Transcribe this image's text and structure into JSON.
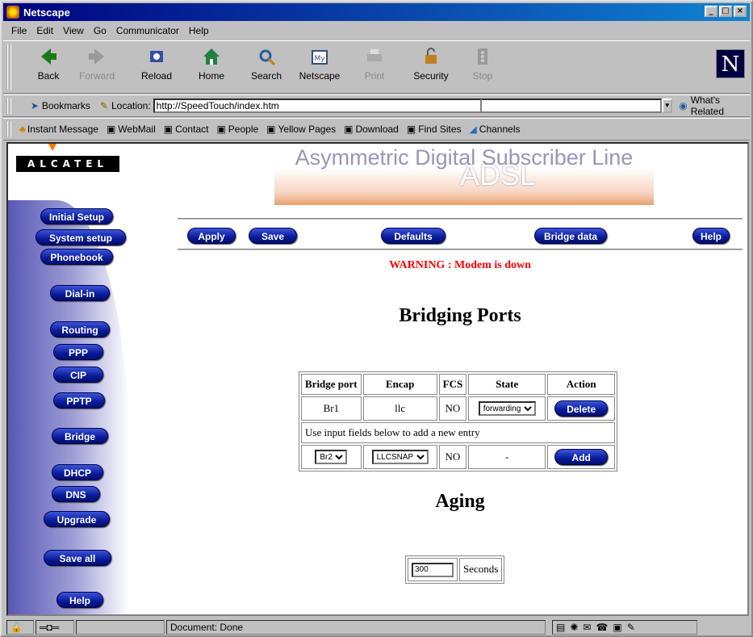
{
  "window": {
    "title": "Netscape"
  },
  "menu": [
    "File",
    "Edit",
    "View",
    "Go",
    "Communicator",
    "Help"
  ],
  "toolbar": {
    "buttons": [
      {
        "label": "Back",
        "icon": "back-arrow-icon",
        "enabled": true
      },
      {
        "label": "Forward",
        "icon": "forward-arrow-icon",
        "enabled": false
      },
      {
        "label": "Reload",
        "icon": "reload-icon",
        "enabled": true
      },
      {
        "label": "Home",
        "icon": "home-icon",
        "enabled": true
      },
      {
        "label": "Search",
        "icon": "search-icon",
        "enabled": true
      },
      {
        "label": "Netscape",
        "icon": "netscape-icon",
        "enabled": true
      },
      {
        "label": "Print",
        "icon": "print-icon",
        "enabled": false
      },
      {
        "label": "Security",
        "icon": "lock-icon",
        "enabled": true
      },
      {
        "label": "Stop",
        "icon": "stop-icon",
        "enabled": false
      }
    ]
  },
  "location": {
    "bookmarks_label": "Bookmarks",
    "location_label": "Location:",
    "url": "http://SpeedTouch/index.htm",
    "whats_related": "What's Related"
  },
  "personal": [
    "Instant Message",
    "WebMail",
    "Contact",
    "People",
    "Yellow Pages",
    "Download",
    "Find Sites",
    "Channels"
  ],
  "page": {
    "logo": "ALCATEL",
    "banner_text": "Asymmetric Digital Subscriber Line",
    "banner_big": "ADSL",
    "sidebar": [
      "Initial Setup",
      "System setup",
      "Phonebook",
      "Dial-in",
      "Routing",
      "PPP",
      "CIP",
      "PPTP",
      "Bridge",
      "DHCP",
      "DNS",
      "Upgrade",
      "Save all",
      "Help"
    ],
    "actions": {
      "apply": "Apply",
      "save": "Save",
      "defaults": "Defaults",
      "bridge_data": "Bridge data",
      "help": "Help"
    },
    "warning": "WARNING : Modem is down",
    "heading": "Bridging Ports",
    "table": {
      "headers": [
        "Bridge port",
        "Encap",
        "FCS",
        "State",
        "Action"
      ],
      "row": {
        "port": "Br1",
        "encap": "llc",
        "fcs": "NO",
        "state": "forwarding",
        "action": "Delete"
      },
      "hint": "Use input fields below to add a new entry",
      "new": {
        "port": "Br2",
        "encap": "LLCSNAP",
        "fcs": "NO",
        "state": "-",
        "action": "Add"
      }
    },
    "aging_heading": "Aging",
    "aging_value": "300",
    "aging_unit": "Seconds"
  },
  "status": {
    "text": "Document: Done"
  },
  "colors": {
    "warning": "#ff0000",
    "pill": "#0a1a9a",
    "title_bar": "#000080"
  }
}
